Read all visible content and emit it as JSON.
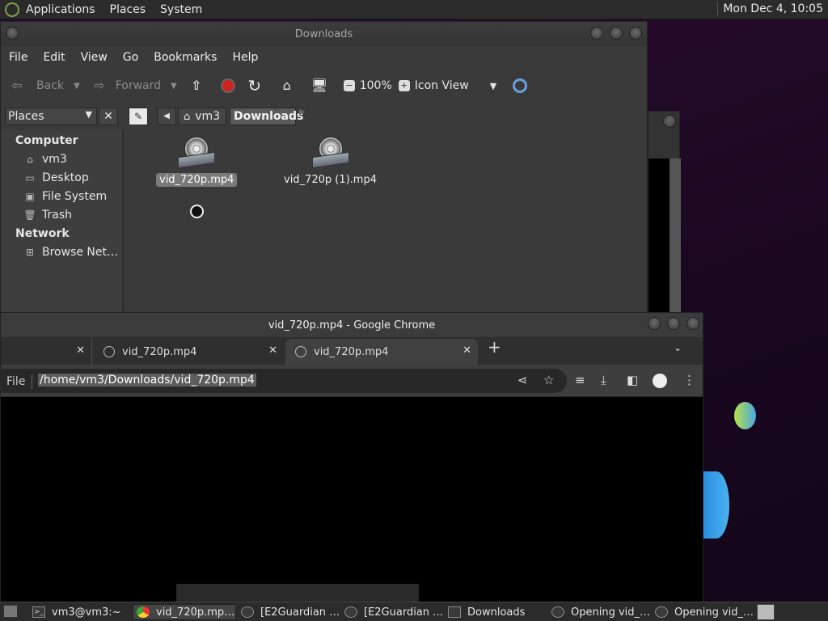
{
  "top_panel": {
    "menus": [
      "Applications",
      "Places",
      "System"
    ],
    "clock": "Mon Dec  4, 10:05"
  },
  "nautilus": {
    "title": "Downloads",
    "menubar": [
      "File",
      "Edit",
      "View",
      "Go",
      "Bookmarks",
      "Help"
    ],
    "toolbar": {
      "back": "Back",
      "forward": "Forward",
      "zoom": "100%",
      "view_mode": "Icon View"
    },
    "places_combo": "Places",
    "breadcrumb": {
      "home": "vm3",
      "current": "Downloads"
    },
    "sidebar": {
      "computer_header": "Computer",
      "computer_items": [
        "vm3",
        "Desktop",
        "File System",
        "Trash"
      ],
      "network_header": "Network",
      "network_items": [
        "Browse Net…"
      ]
    },
    "files": [
      {
        "name": "vid_720p.mp4",
        "selected": true
      },
      {
        "name": "vid_720p (1).mp4",
        "selected": false
      }
    ]
  },
  "chrome": {
    "title": "vid_720p.mp4 - Google Chrome",
    "tabs": [
      {
        "label": ""
      },
      {
        "label": "vid_720p.mp4"
      },
      {
        "label": "vid_720p.mp4",
        "active": true
      }
    ],
    "scheme": "File",
    "url": "/home/vm3/Downloads/vid_720p.mp4"
  },
  "taskbar": {
    "items": [
      {
        "label": "vm3@vm3:~",
        "icon": "terminal-icon"
      },
      {
        "label": "vid_720p.mp…",
        "icon": "chrome-icon",
        "active": true
      },
      {
        "label": "[E2Guardian …",
        "icon": "browser-icon"
      },
      {
        "label": "[E2Guardian …",
        "icon": "browser-icon"
      },
      {
        "label": "Downloads",
        "icon": "folder-icon"
      },
      {
        "label": "Opening vid_…",
        "icon": "film-icon"
      },
      {
        "label": "Opening vid_…",
        "icon": "film-icon"
      }
    ]
  }
}
